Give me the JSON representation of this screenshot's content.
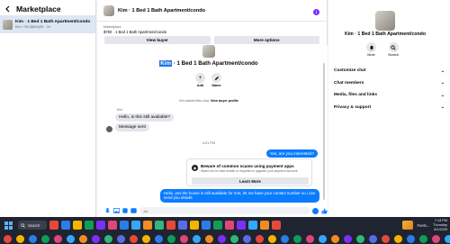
{
  "left": {
    "title": "Marketplace",
    "thread": {
      "name": "Kim · 1 Bed 1 Bath Apartment/condo",
      "sub": "Kim: 750 ($800)39 · 2h"
    }
  },
  "header": {
    "title": "Kim · 1 Bed 1 Bath Apartment/condo"
  },
  "listing": {
    "label": "Marketplace",
    "price": "$750 · 1 Bed 1 Bath Apartment/condo"
  },
  "buttons": {
    "view_buyer": "View buyer",
    "more_options": "More options"
  },
  "conversation": {
    "title_highlight": "Kim",
    "title_rest": " · 1 Bed 1 Bath Apartment/condo",
    "add_label": "Add",
    "name_label": "Name",
    "started_text": "Kim started this chat.",
    "view_profile": "View buyer profile",
    "sender": "Kim",
    "msg_in_1": "Hello, is this still available?",
    "msg_in_2": "Message sent",
    "time": "4:01 PM",
    "msg_out_1": "Yes, are you interested?",
    "warning_title": "Beware of common scams using payment apps",
    "warning_sub": "Watch out for fake emails or requests to upgrade your payment account.",
    "learn_more": "Learn More",
    "msg_out_2": "Hello, yes the house is still available for rent, let me have your contact number so i can send you details"
  },
  "composer": {
    "placeholder": "Aa"
  },
  "right": {
    "title": "Kim · 1 Bed 1 Bath Apartment/condo",
    "mute": "Mute",
    "search": "Search",
    "sections": [
      "Customize chat",
      "Chat members",
      "Media, files and links",
      "Privacy & support"
    ]
  },
  "taskbar": {
    "search": "Search",
    "weather": "Feels...",
    "time": "7:14 PM",
    "day": "Thursday",
    "date": "8/1/2025",
    "app_colors": [
      "#e8483c",
      "#2b7de9",
      "#f4b400",
      "#0f9d58",
      "#7b2ff7",
      "#e0457b",
      "#2b7de9",
      "#35a7ff",
      "#f28b22",
      "#33b679",
      "#e8483c",
      "#5b6be8",
      "#f4b400",
      "#2b7de9",
      "#0f9d58",
      "#e0457b",
      "#7b2ff7",
      "#35a7ff",
      "#f28b22",
      "#e8483c"
    ],
    "dock_colors": [
      "#e8483c",
      "#f4b400",
      "#2b7de9",
      "#0f9d58",
      "#e0457b",
      "#35a7ff",
      "#f28b22",
      "#7b2ff7",
      "#33b679",
      "#5b6be8",
      "#e8483c",
      "#f4b400",
      "#2b7de9",
      "#0f9d58",
      "#e0457b",
      "#35a7ff",
      "#f28b22",
      "#7b2ff7",
      "#33b679",
      "#5b6be8",
      "#e8483c",
      "#f4b400",
      "#2b7de9",
      "#0f9d58",
      "#e0457b",
      "#35a7ff",
      "#f28b22",
      "#7b2ff7",
      "#33b679",
      "#5b6be8",
      "#e8483c",
      "#f4b400",
      "#2b7de9",
      "#0f9d58",
      "#e0457b",
      "#35a7ff",
      "#f28b22",
      "#7b2ff7",
      "#33b679",
      "#5b6be8",
      "#e8483c",
      "#f4b400",
      "#2b7de9",
      "#0f9d58",
      "#e0457b",
      "#35a7ff",
      "#f28b22",
      "#7b2ff7",
      "#33b679",
      "#5b6be8",
      "#e8483c",
      "#f4b400",
      "#2b7de9",
      "#0f9d58",
      "#e0457b",
      "#35a7ff",
      "#f28b22",
      "#7b2ff7",
      "#33b679",
      "#5b6be8",
      "#e8483c",
      "#f4b400",
      "#2b7de9",
      "#0f9d58",
      "#e0457b",
      "#35a7ff",
      "#f28b22",
      "#7b2ff7",
      "#33b679",
      "#5b6be8",
      "#e8483c",
      "#f4b400",
      "#2b7de9",
      "#0f9d58",
      "#e0457b",
      "#35a7ff",
      "#f28b22",
      "#7b2ff7",
      "#33b679",
      "#5b6be8",
      "#e8483c",
      "#f4b400",
      "#2b7de9",
      "#0f9d58",
      "#e0457b",
      "#35a7ff",
      "#f28b22",
      "#7b2ff7",
      "#33b679",
      "#5b6be8",
      "#e8483c",
      "#f4b400",
      "#2b7de9",
      "#0f9d58",
      "#e0457b",
      "#35a7ff",
      "#f28b22",
      "#7b2ff7",
      "#33b679",
      "#5b6be8",
      "#e8483c",
      "#f4b400",
      "#2b7de9",
      "#0f9d58",
      "#e0457b",
      "#35a7ff",
      "#f28b22",
      "#7b2ff7",
      "#33b679",
      "#5b6be8",
      "#e8483c",
      "#f4b400",
      "#2b7de9",
      "#0f9d58",
      "#e0457b",
      "#35a7ff",
      "#f28b22",
      "#7b2ff7",
      "#33b679",
      "#5b6be8"
    ]
  }
}
